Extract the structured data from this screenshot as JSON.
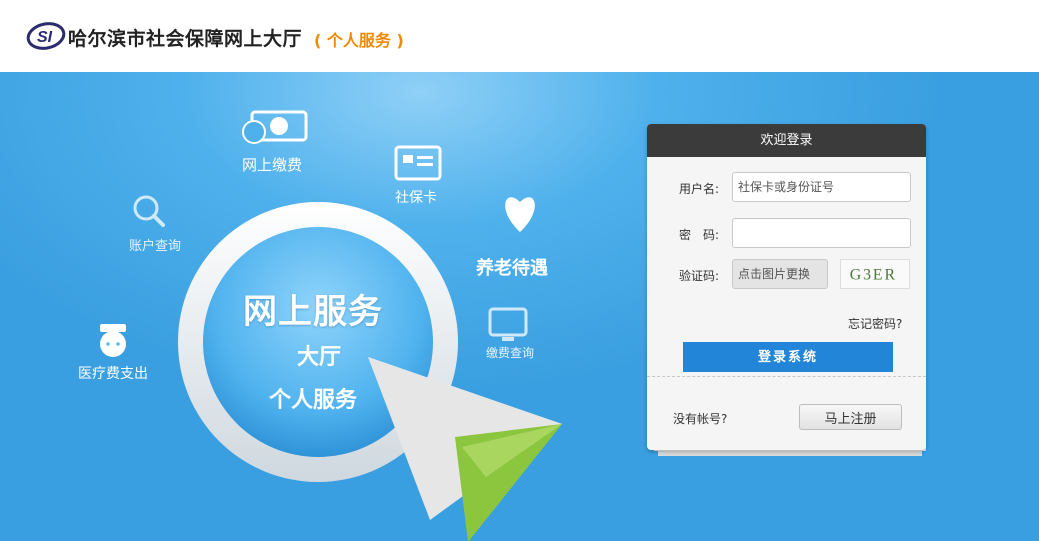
{
  "header": {
    "logo_text": "SI",
    "title": "哈尔滨市社会保障网上大厅",
    "subtitle": "( 个人服务 )"
  },
  "features": {
    "online_payment": "网上缴费",
    "social_card": "社保卡",
    "account_query": "账户查询",
    "pension": "养老待遇",
    "fee_query": "缴费查询",
    "medical": "医疗费支出"
  },
  "center": {
    "title": "网上服务",
    "line1": "大厅",
    "line2": "个人服务"
  },
  "login": {
    "title": "欢迎登录",
    "username_label": "用户名:",
    "username_placeholder": "社保卡或身份证号",
    "password_label": "密　码:",
    "captcha_label": "验证码:",
    "captcha_placeholder": "点击图片更换",
    "captcha_text": "G3ER",
    "forgot": "忘记密码?",
    "submit": "登录系统",
    "no_account": "没有帐号?",
    "register": "马上注册"
  },
  "colors": {
    "accent": "#f08a00",
    "primary_button": "#2285d8",
    "banner": "#3a9fe0",
    "login_header": "#3b3b3b",
    "plane_green": "#8cc63f"
  },
  "icons": [
    "logo-icon",
    "money-icon",
    "card-icon",
    "search-icon",
    "heart-hands-icon",
    "monitor-icon",
    "nurse-icon",
    "paper-plane-icon"
  ]
}
